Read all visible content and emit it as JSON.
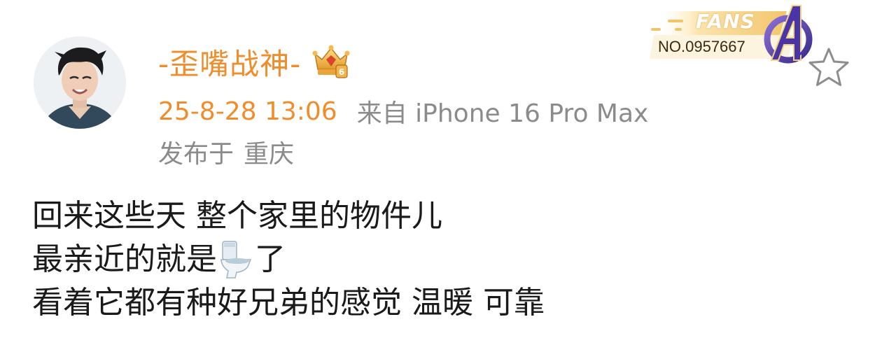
{
  "post": {
    "username": "-歪嘴战神-",
    "timestamp": "25-8-28 13:06",
    "source": "来自 iPhone 16 Pro Max",
    "location_label": "发布于",
    "location": "重庆",
    "content": {
      "line1": "回来这些天 整个家里的物件儿",
      "line2_before": "最亲近的就是",
      "line2_emoji": "toilet-emoji",
      "line2_after": "了",
      "line3": "看着它都有种好兄弟的感觉 温暖 可靠"
    }
  },
  "fans_badge": {
    "title": "FANS",
    "number": "NO.0957667",
    "logo": "avengers-logo"
  },
  "icons": {
    "vip": "vip-crown-icon",
    "favorite": "star-outline-icon"
  },
  "colors": {
    "username": "#f08c2a",
    "timestamp": "#f08c2a",
    "meta": "#8b8b8b",
    "text": "#1a1a1a",
    "badge_gold": "#f2c56b"
  }
}
